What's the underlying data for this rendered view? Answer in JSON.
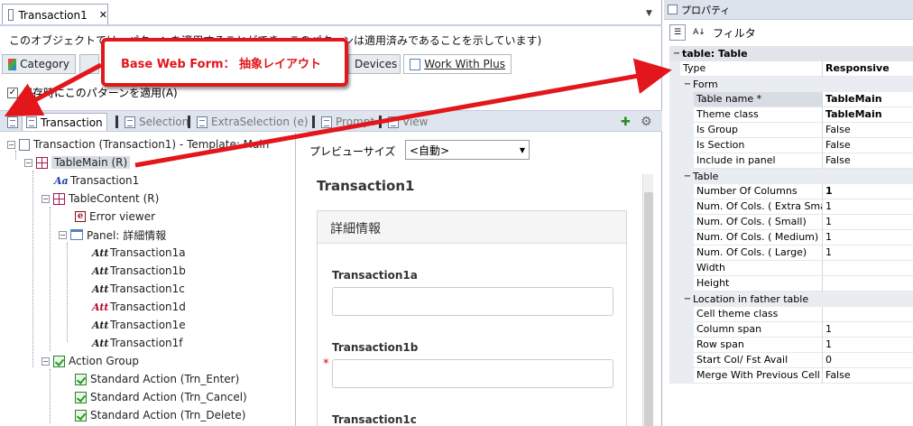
{
  "document_tab": {
    "title": "Transaction1",
    "close": "✕",
    "dropdown": "▼"
  },
  "description": "このオブジェクトでは、パターンを適用することができ、このパターンは適用済みであることを示しています)",
  "pattern_tabs": [
    "Category",
    "Devices",
    "Work With Plus"
  ],
  "apply_pattern_label": "保存時にこのパターンを適用(A)",
  "apply_pattern_checked": "✓",
  "sub_tabs": [
    "Transaction",
    "Selection",
    "ExtraSelection (e)",
    "Prompt",
    "View"
  ],
  "tree": {
    "root": "Transaction (Transaction1) - Template: Main",
    "nodes": [
      {
        "label": "TableMain (R)",
        "icon": "grid-icon"
      },
      {
        "label": "Transaction1",
        "icon": "text-block-icon"
      },
      {
        "label": "TableContent (R)",
        "icon": "grid-icon"
      },
      {
        "label": "Error viewer",
        "icon": "error-viewer-icon"
      },
      {
        "label": "Panel: 詳細情報",
        "icon": "panel-icon"
      },
      {
        "label": "Transaction1a",
        "icon": "attribute-icon"
      },
      {
        "label": "Transaction1b",
        "icon": "attribute-icon"
      },
      {
        "label": "Transaction1c",
        "icon": "attribute-icon"
      },
      {
        "label": "Transaction1d",
        "icon": "attribute-icon"
      },
      {
        "label": "Transaction1e",
        "icon": "attribute-icon"
      },
      {
        "label": "Transaction1f",
        "icon": "attribute-icon"
      },
      {
        "label": "Action Group",
        "icon": "action-icon"
      },
      {
        "label": "Standard Action (Trn_Enter)",
        "icon": "action-icon"
      },
      {
        "label": "Standard Action (Trn_Cancel)",
        "icon": "action-icon"
      },
      {
        "label": "Standard Action (Trn_Delete)",
        "icon": "action-icon"
      }
    ]
  },
  "preview": {
    "size_label": "プレビューサイズ",
    "size_value": "<自動>",
    "title": "Transaction1",
    "panel_title": "詳細情報",
    "fields": [
      {
        "label": "Transaction1a",
        "required": ""
      },
      {
        "label": "Transaction1b",
        "required": "*"
      },
      {
        "label": "Transaction1c",
        "required": ""
      }
    ]
  },
  "properties": {
    "title": "プロパティ",
    "filter_label": "フィルタ",
    "header": "table: Table",
    "type": {
      "key": "Type",
      "value": "Responsive"
    },
    "groups": [
      {
        "name": "Form",
        "rows": [
          {
            "key": "Table name *",
            "value": "TableMain",
            "bold": true
          },
          {
            "key": "Theme class",
            "value": "TableMain",
            "bold": true
          },
          {
            "key": "Is Group",
            "value": "False"
          },
          {
            "key": "Is Section",
            "value": "False"
          },
          {
            "key": "Include in panel",
            "value": "False"
          }
        ]
      },
      {
        "name": "Table",
        "rows": [
          {
            "key": "Number Of Columns",
            "value": "1",
            "bold": true
          },
          {
            "key": "Num. Of Cols. ( Extra Small)",
            "value": "1"
          },
          {
            "key": "Num. Of Cols. ( Small)",
            "value": "1"
          },
          {
            "key": "Num. Of Cols. ( Medium)",
            "value": "1"
          },
          {
            "key": "Num. Of Cols. ( Large)",
            "value": "1"
          },
          {
            "key": "Width",
            "value": ""
          },
          {
            "key": "Height",
            "value": ""
          }
        ]
      },
      {
        "name": "Location in father table",
        "rows": [
          {
            "key": "Cell theme class",
            "value": ""
          },
          {
            "key": "Column span",
            "value": "1"
          },
          {
            "key": "Row span",
            "value": "1"
          },
          {
            "key": "Start Col/ Fst Avail",
            "value": "0"
          },
          {
            "key": "Merge With Previous Cell",
            "value": "False"
          }
        ]
      }
    ]
  },
  "callout": "Base Web Form： 抽象レイアウト",
  "colors": {
    "accent_red": "#e3161b",
    "selection": "#d8dde5"
  }
}
